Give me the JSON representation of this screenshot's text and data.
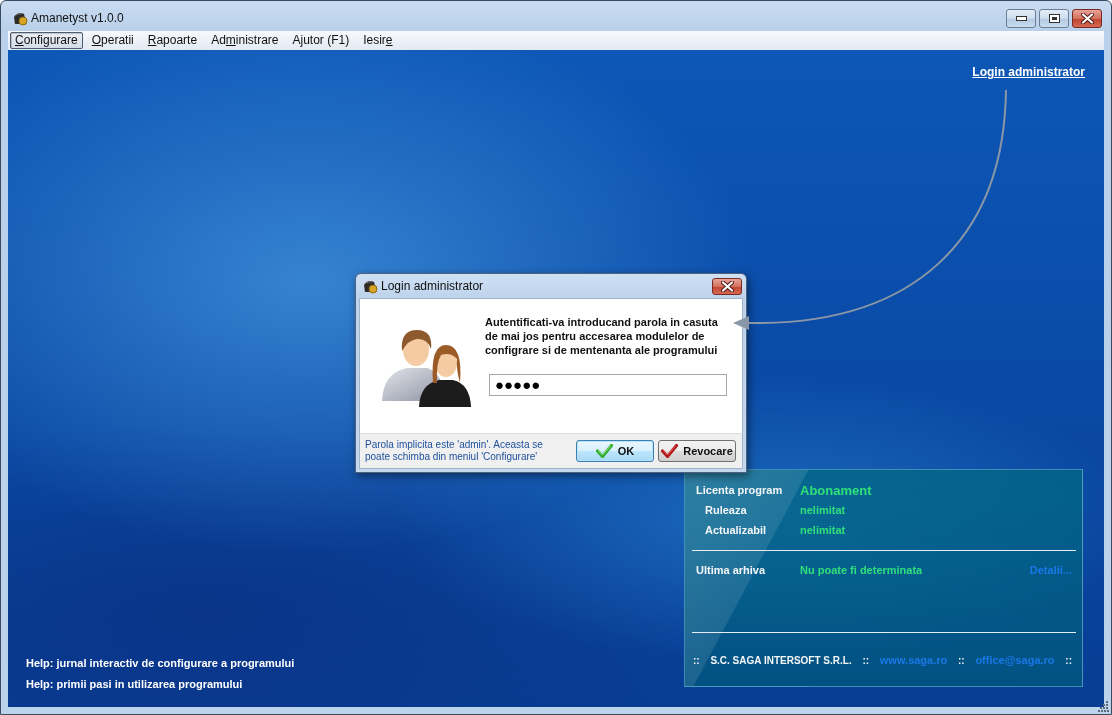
{
  "window": {
    "title": "Amanetyst v1.0.0"
  },
  "menu": [
    {
      "access_key": "C",
      "text_after": "onfigurare",
      "selected": true
    },
    {
      "access_key": "O",
      "text_after": "peratii",
      "selected": false
    },
    {
      "access_key": "R",
      "text_after": "apoarte",
      "selected": false
    },
    {
      "text_before": "Ad",
      "access_key": "m",
      "text_after": "inistrare",
      "selected": false
    },
    {
      "text_before": "Ajutor (F1)",
      "selected": false
    },
    {
      "text_before": "Iesir",
      "access_key": "e",
      "selected": false
    }
  ],
  "header_link": {
    "label": "Login administrator"
  },
  "dialog": {
    "title": "Login administrator",
    "message_lines": [
      "Autentificati-va introducand parola in casuta",
      "de mai jos pentru accesarea modulelor de",
      "configrare si de mentenanta ale programului"
    ],
    "password": {
      "value": "●●●●●"
    },
    "hint_lines": [
      "Parola implicita este 'admin'. Aceasta se",
      "poate schimba din meniul 'Configurare'"
    ],
    "buttons": [
      {
        "kind": "ok",
        "label": "OK",
        "focused": true
      },
      {
        "kind": "cancel",
        "label": "Revocare",
        "focused": false
      }
    ]
  },
  "license_panel": {
    "rows": [
      {
        "kind": "main",
        "label": "Licenta program",
        "value": "Abonament"
      },
      {
        "kind": "sub",
        "label": "Ruleaza",
        "value": "nelimitat"
      },
      {
        "kind": "sub",
        "label": "Actualizabil",
        "value": "nelimitat"
      }
    ],
    "archive": {
      "label": "Ultima arhiva",
      "value": "Nu poate fi determinata",
      "link": "Detalii..."
    },
    "footer": [
      {
        "kind": "separator",
        "text": "::"
      },
      {
        "kind": "company",
        "text": "S.C. SAGA INTERSOFT S.R.L."
      },
      {
        "kind": "separator",
        "text": "::"
      },
      {
        "kind": "link",
        "text": "www.saga.ro"
      },
      {
        "kind": "separator",
        "text": "::"
      },
      {
        "kind": "link",
        "text": "office@saga.ro"
      },
      {
        "kind": "separator",
        "text": "::"
      }
    ]
  },
  "help_links": [
    "Help: jurnal interactiv de configurare a programului",
    "Help: primii pasi in utilizarea programului"
  ]
}
